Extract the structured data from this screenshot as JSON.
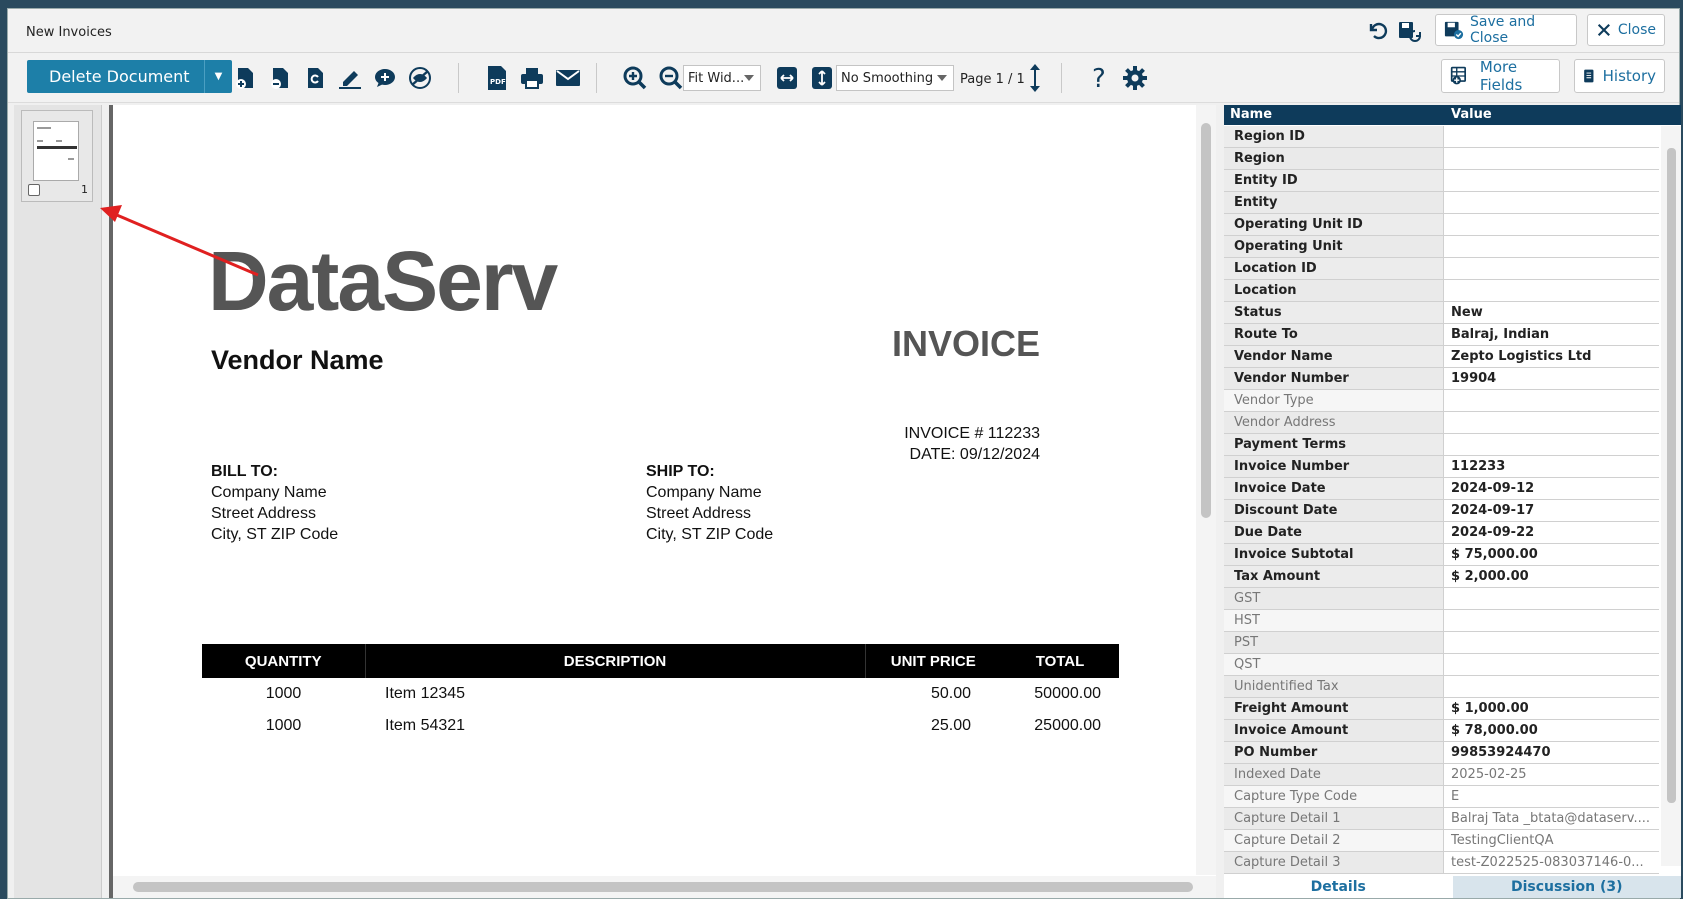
{
  "window": {
    "title": "New Invoices",
    "save_close_label": "Save and Close",
    "close_label": "Close"
  },
  "toolbar": {
    "delete_label": "Delete Document",
    "zoom_select": "Fit Wid...",
    "smoothing_select": "No Smoothing",
    "page_label": "Page 1 / 1",
    "more_fields_label": "More Fields",
    "history_label": "History"
  },
  "thumbnails": {
    "page_number": "1"
  },
  "document": {
    "logo_text": "DataServ",
    "invoice_title": "INVOICE",
    "vendor_name": "Vendor Name",
    "invoice_number_line": "INVOICE # 112233",
    "date_line": "DATE: 09/12/2024",
    "bill_to": {
      "heading": "BILL TO:",
      "line1": "Company Name",
      "line2": "Street Address",
      "line3": "City, ST ZIP Code"
    },
    "ship_to": {
      "heading": "SHIP TO:",
      "line1": "Company Name",
      "line2": "Street Address",
      "line3": "City, ST ZIP Code"
    },
    "table": {
      "headers": [
        "QUANTITY",
        "DESCRIPTION",
        "UNIT PRICE",
        "TOTAL"
      ],
      "rows": [
        [
          "1000",
          "Item 12345",
          "50.00",
          "50000.00"
        ],
        [
          "1000",
          "Item 54321",
          "25.00",
          "25000.00"
        ]
      ]
    }
  },
  "panel": {
    "col_name": "Name",
    "col_value": "Value",
    "fields": [
      {
        "name": "Region ID",
        "value": ""
      },
      {
        "name": "Region",
        "value": ""
      },
      {
        "name": "Entity ID",
        "value": ""
      },
      {
        "name": "Entity",
        "value": ""
      },
      {
        "name": "Operating Unit ID",
        "value": ""
      },
      {
        "name": "Operating Unit",
        "value": ""
      },
      {
        "name": "Location ID",
        "value": ""
      },
      {
        "name": "Location",
        "value": ""
      },
      {
        "name": "Status",
        "value": "New"
      },
      {
        "name": "Route To",
        "value": "Balraj, Indian"
      },
      {
        "name": "Vendor Name",
        "value": "Zepto Logistics Ltd"
      },
      {
        "name": "Vendor Number",
        "value": "19904"
      },
      {
        "name": "Vendor Type",
        "value": ""
      },
      {
        "name": "Vendor Address",
        "value": ""
      },
      {
        "name": "Payment Terms",
        "value": ""
      },
      {
        "name": "Invoice Number",
        "value": "112233"
      },
      {
        "name": "Invoice Date",
        "value": "2024-09-12"
      },
      {
        "name": "Discount Date",
        "value": "2024-09-17"
      },
      {
        "name": "Due Date",
        "value": "2024-09-22"
      },
      {
        "name": "Invoice Subtotal",
        "value": "$ 75,000.00"
      },
      {
        "name": "Tax Amount",
        "value": "$ 2,000.00"
      },
      {
        "name": "GST",
        "value": ""
      },
      {
        "name": "HST",
        "value": ""
      },
      {
        "name": "PST",
        "value": ""
      },
      {
        "name": "QST",
        "value": ""
      },
      {
        "name": "Unidentified Tax",
        "value": ""
      },
      {
        "name": "Freight Amount",
        "value": "$ 1,000.00"
      },
      {
        "name": "Invoice Amount",
        "value": "$ 78,000.00"
      },
      {
        "name": "PO Number",
        "value": "99853924470"
      },
      {
        "name": "Indexed Date",
        "value": "2025-02-25"
      },
      {
        "name": "Capture Type Code",
        "value": "E"
      },
      {
        "name": "Capture Detail 1",
        "value": "Balraj Tata _btata@dataserv...."
      },
      {
        "name": "Capture Detail 2",
        "value": "TestingClientQA"
      },
      {
        "name": "Capture Detail 3",
        "value": "test-Z022525-083037146-0..."
      }
    ],
    "tab_details": "Details",
    "tab_discussion": "Discussion (3)"
  }
}
